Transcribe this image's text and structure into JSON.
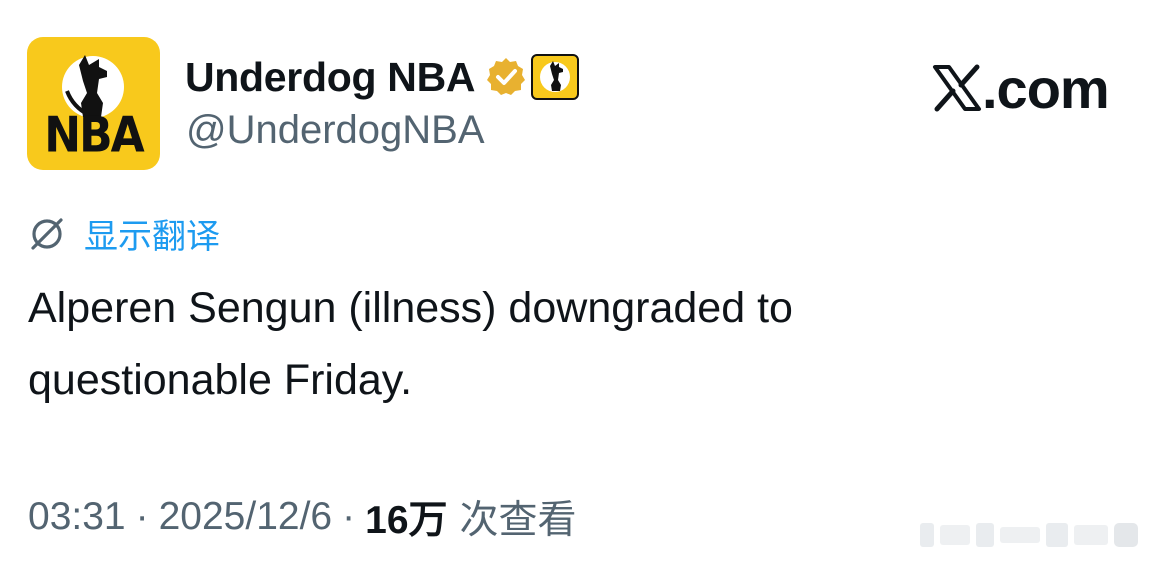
{
  "header": {
    "display_name": "Underdog NBA",
    "handle": "@UnderdogNBA",
    "avatar_text": "NBA",
    "avatar_icon": "underdog-dog-logo",
    "verified_icon": "gold-verified-badge",
    "affiliate_icon": "underdog-affiliate-badge",
    "site_logo_text": ".com",
    "site_logo_icon": "x-logo"
  },
  "translate": {
    "icon": "globe-translate-icon",
    "label": "显示翻译"
  },
  "tweet": {
    "lines": [
      "Alperen Sengun (illness) downgraded to",
      "questionable Friday."
    ]
  },
  "meta": {
    "time": "03:31",
    "separator": "·",
    "date": "2025/12/6",
    "views_count": "16万",
    "views_label": "次查看"
  },
  "colors": {
    "brand_yellow": "#f8c91c",
    "link_blue": "#1d9bf0",
    "text_primary": "#0f1419",
    "text_secondary": "#536471",
    "verified_gold": "#e8b130"
  }
}
